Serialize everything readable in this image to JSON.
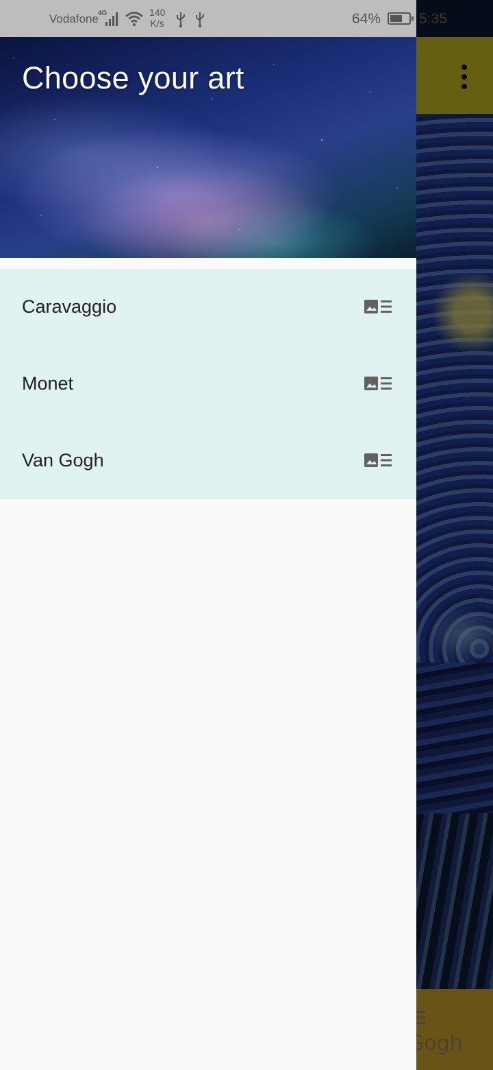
{
  "status_bar": {
    "carrier": "Vodafone",
    "network": "4G",
    "speed_value": "140",
    "speed_unit": "K/s",
    "battery_percent": "64%",
    "battery_level": 0.64,
    "time": "5:35"
  },
  "drawer": {
    "title": "Choose your art",
    "items": [
      {
        "label": "Caravaggio",
        "icon": "gallery-list-icon"
      },
      {
        "label": "Monet",
        "icon": "gallery-list-icon"
      },
      {
        "label": "Van Gogh",
        "icon": "gallery-list-icon"
      }
    ]
  },
  "background_app": {
    "bottom_label": "Gogh",
    "menu_glyph": "☰"
  },
  "colors": {
    "drawer_list_bg": "#e0f2f1",
    "app_bar": "#b9ad1e",
    "bottom_bar": "#c09a2a"
  }
}
